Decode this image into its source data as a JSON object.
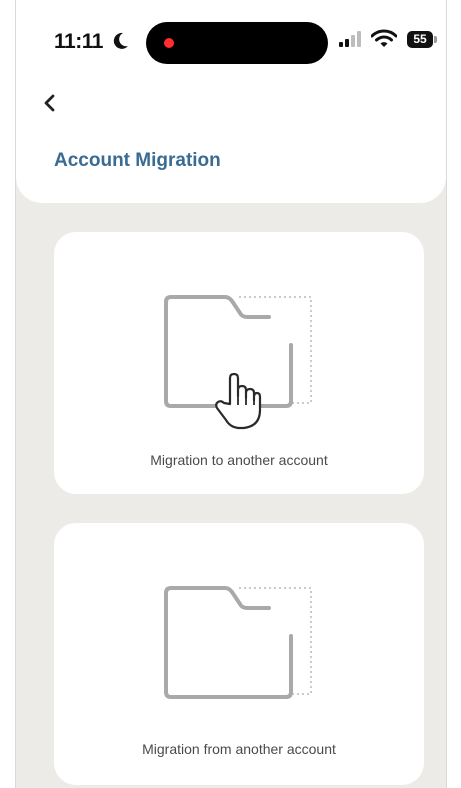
{
  "status_bar": {
    "time": "11:11",
    "battery": "55",
    "icons": [
      "moon-icon",
      "recording-dot-icon",
      "signal-icon",
      "wifi-icon",
      "battery-icon"
    ]
  },
  "header": {
    "back_icon": "chevron-left-icon",
    "title": "Account Migration"
  },
  "options": [
    {
      "label": "Migration to another account",
      "icon": "folder-outline-icon"
    },
    {
      "label": "Migration from another account",
      "icon": "folder-outline-icon"
    }
  ],
  "colors": {
    "title": "#3a6b93",
    "background": "#ecebe7",
    "card": "#ffffff",
    "icon_stroke": "#a9a9a9",
    "recording_dot": "#ff2d2d"
  }
}
